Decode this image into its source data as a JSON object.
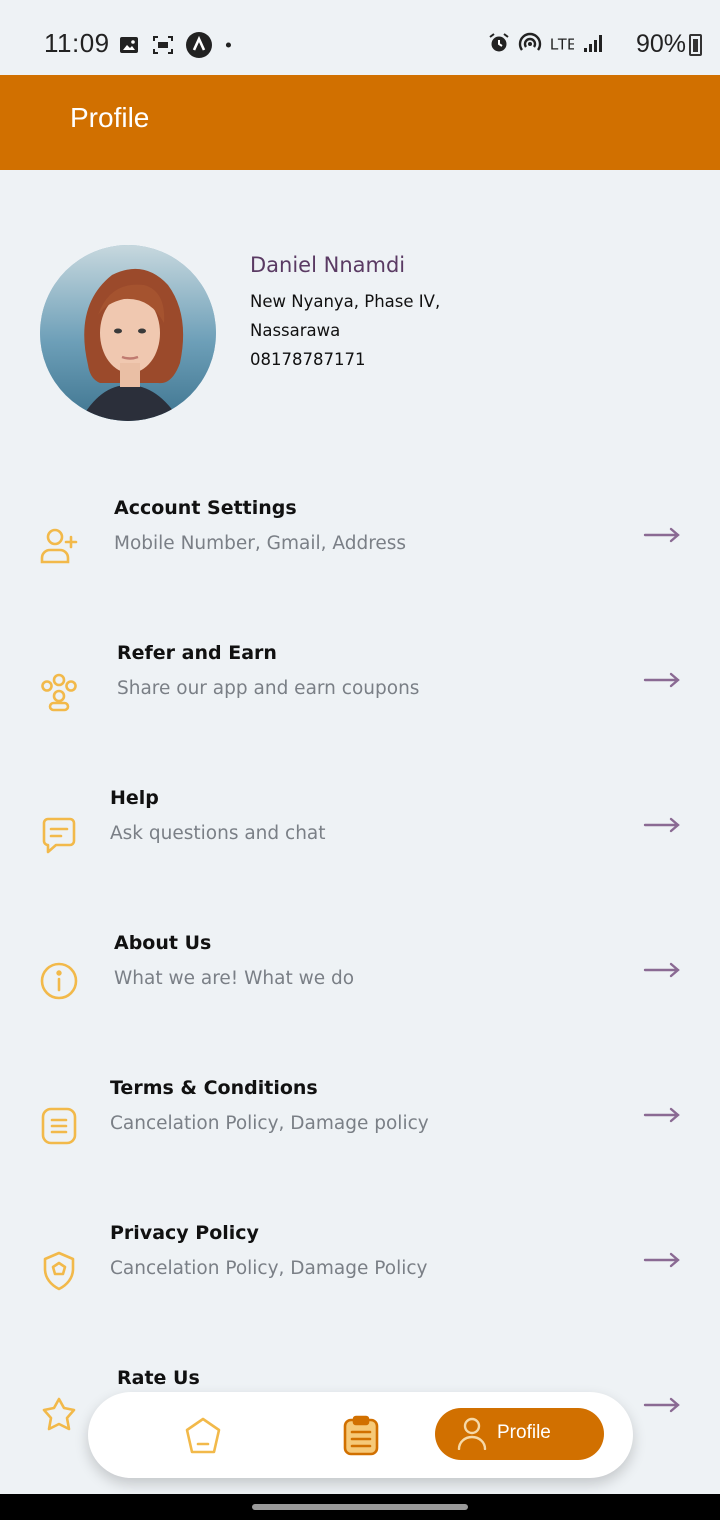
{
  "status_bar": {
    "time": "11:09",
    "battery": "90%",
    "network": "LTE",
    "left_icons": [
      "image-icon",
      "screenshot-icon",
      "app-icon",
      "dot-icon"
    ],
    "right_icons": [
      "alarm-icon",
      "hotspot-icon",
      "lte-icon",
      "signal-icon",
      "battery-icon"
    ]
  },
  "header": {
    "title": "Profile"
  },
  "profile": {
    "name": "Daniel Nnamdi",
    "address_line1": "New Nyanya, Phase IV,",
    "address_line2": "Nassarawa",
    "phone": "08178787171"
  },
  "menu": [
    {
      "label": "Account Settings",
      "sub": "Mobile Number, Gmail, Address",
      "icon": "add-user-icon"
    },
    {
      "label": "Refer and Earn",
      "sub": "Share our app and earn coupons",
      "icon": "group-icon"
    },
    {
      "label": "Help",
      "sub": "Ask questions and chat",
      "icon": "chat-icon"
    },
    {
      "label": "About Us",
      "sub": "What we are! What we do",
      "icon": "info-icon"
    },
    {
      "label": "Terms & Conditions",
      "sub": "Cancelation Policy, Damage policy",
      "icon": "document-icon"
    },
    {
      "label": "Privacy Policy",
      "sub": "Cancelation Policy, Damage Policy",
      "icon": "shield-icon"
    },
    {
      "label": "Rate Us",
      "sub": "",
      "icon": "star-icon"
    }
  ],
  "bottom_nav": {
    "items": [
      {
        "name": "home",
        "icon": "home-icon"
      },
      {
        "name": "orders",
        "icon": "clipboard-icon"
      },
      {
        "name": "profile",
        "icon": "user-icon",
        "label": "Profile",
        "active": true
      }
    ]
  },
  "colors": {
    "accent": "#d17000",
    "icon_accent": "#f2b94a",
    "name_color": "#5a3a63",
    "arrow_color": "#8a6a93",
    "background": "#eef2f5"
  }
}
